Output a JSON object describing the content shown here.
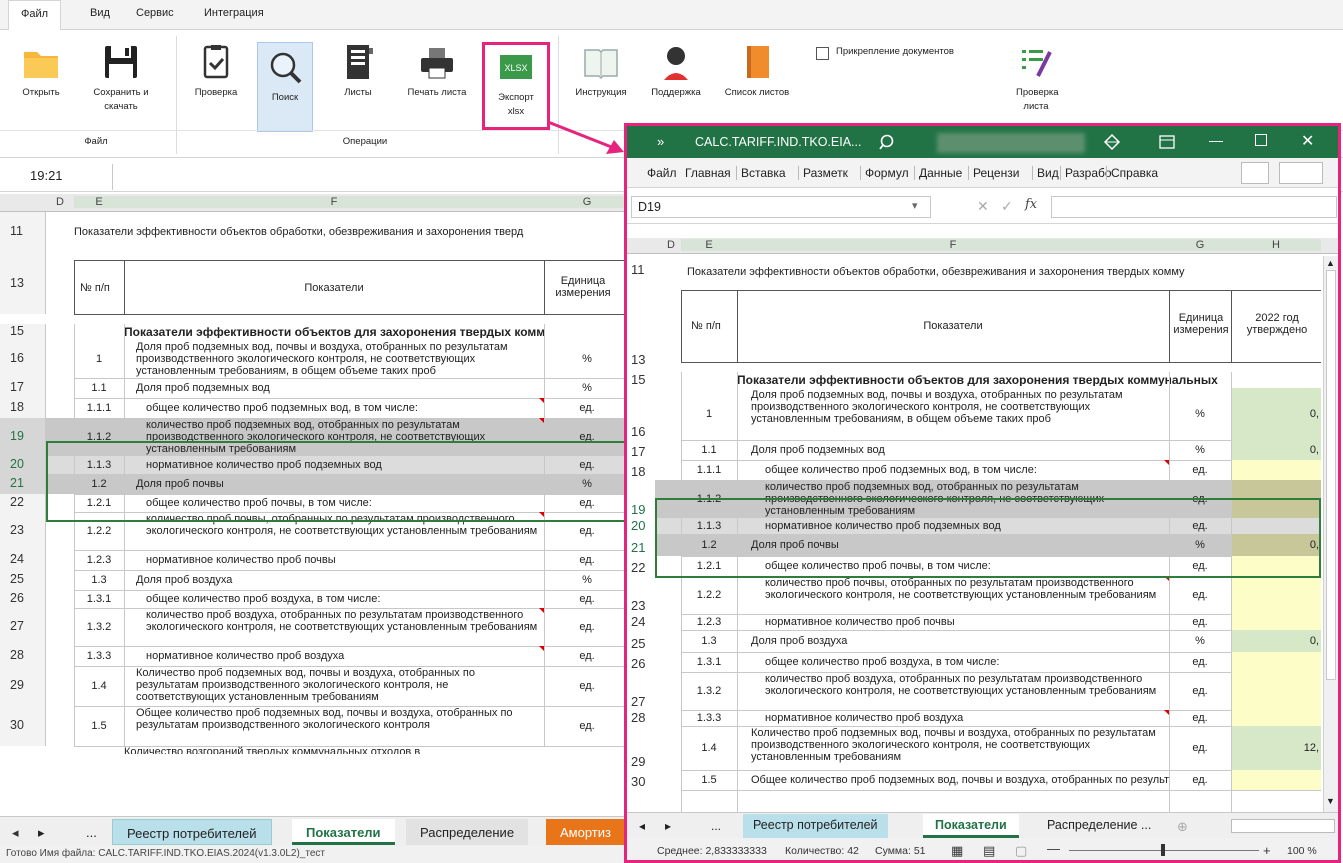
{
  "left_app": {
    "menu": [
      "Файл",
      "Вид",
      "Сервис",
      "Интеграция"
    ],
    "ribbon": {
      "buttons": [
        {
          "id": "open",
          "label": "Открыть"
        },
        {
          "id": "save",
          "label": "Сохранить и скачать"
        },
        {
          "id": "check",
          "label": "Проверка"
        },
        {
          "id": "search",
          "label": "Поиск"
        },
        {
          "id": "sheets",
          "label": "Листы"
        },
        {
          "id": "print",
          "label": "Печать листа"
        },
        {
          "id": "export",
          "label": "Экспорт xlsx",
          "icon_text": "XLSX"
        },
        {
          "id": "manual",
          "label": "Инструкция"
        },
        {
          "id": "support",
          "label": "Поддержка"
        },
        {
          "id": "sheetlist",
          "label": "Список листов"
        },
        {
          "id": "sheetcheck",
          "label": "Проверка листа"
        }
      ],
      "attach_docs_label": "Прикрепление документов",
      "group_file": "Файл",
      "group_ops": "Операции"
    },
    "time": "19:21",
    "col_headers": [
      "D",
      "E",
      "F",
      "G"
    ],
    "header_title": "Показатели эффективности объектов обработки, обезвреживания и захоронения тверд",
    "table_head": {
      "num": "№ п/п",
      "ind": "Показатели",
      "unit": "Единица измерения"
    },
    "section_title": "Показатели эффективности объектов для захоронения твердых комм",
    "rows": [
      {
        "r": "16",
        "n": "1",
        "t": "Доля проб подземных вод, почвы и воздуха, отобранных по результатам производственного экологического контроля, не соответствующих установленным требованиям, в общем объеме таких проб",
        "u": "%"
      },
      {
        "r": "17",
        "n": "1.1",
        "t": "Доля проб подземных вод",
        "u": "%"
      },
      {
        "r": "18",
        "n": "1.1.1",
        "t": "общее количество проб подземных вод, в том числе:",
        "u": "ед."
      },
      {
        "r": "19",
        "n": "1.1.2",
        "t": "количество проб подземных вод, отобранных по результатам производственного экологического контроля, не соответствующих установленным требованиям",
        "u": "ед."
      },
      {
        "r": "20",
        "n": "1.1.3",
        "t": "нормативное количество проб подземных вод",
        "u": "ед."
      },
      {
        "r": "21",
        "n": "1.2",
        "t": "Доля проб почвы",
        "u": "%"
      },
      {
        "r": "22",
        "n": "1.2.1",
        "t": "общее количество проб почвы, в том числе:",
        "u": "ед."
      },
      {
        "r": "23",
        "n": "1.2.2",
        "t": "количество проб почвы, отобранных по результатам производственного экологического контроля, не соответствующих установленным требованиям",
        "u": "ед."
      },
      {
        "r": "24",
        "n": "1.2.3",
        "t": "нормативное количество проб почвы",
        "u": "ед."
      },
      {
        "r": "25",
        "n": "1.3",
        "t": "Доля проб воздуха",
        "u": "%"
      },
      {
        "r": "26",
        "n": "1.3.1",
        "t": "общее количество проб воздуха, в том числе:",
        "u": "ед."
      },
      {
        "r": "27",
        "n": "1.3.2",
        "t": "количество проб воздуха, отобранных по результатам производственного экологического контроля, не соответствующих установленным требованиям",
        "u": "ед."
      },
      {
        "r": "28",
        "n": "1.3.3",
        "t": "нормативное количество проб воздуха",
        "u": "ед."
      },
      {
        "r": "29",
        "n": "1.4",
        "t": "Количество проб подземных вод, почвы и воздуха, отобранных по результатам производственного экологического контроля, не соответствующих установленным требованиям",
        "u": "ед."
      },
      {
        "r": "30",
        "n": "1.5",
        "t": "Общее количество проб подземных вод, почвы и воздуха, отобранных по результатам производственного экологического контроля",
        "u": "ед."
      }
    ],
    "last_row_partial": "Количество возгораний твердых коммунальных отходов в",
    "tabs": [
      "Реестр потребителей",
      "Показатели",
      "Распределение",
      "Амортиз"
    ],
    "tab_more": "...",
    "status": "Готово   Имя файла: CALC.TARIFF.IND.TKO.EIAS.2024(v1.3.0L2)_тест"
  },
  "excel": {
    "title": "CALC.TARIFF.IND.TKO.EIA...",
    "title_chevrons": "»",
    "menu": [
      "Файл",
      "Главная",
      "Вставка",
      "Разметк",
      "Формул",
      "Данные",
      "Рецензи",
      "Вид",
      "Разрабо",
      "Справка"
    ],
    "namebox": "D19",
    "fx": "fx",
    "col_headers": [
      "D",
      "E",
      "F",
      "G",
      "H"
    ],
    "header_title": "Показатели эффективности объектов обработки, обезвреживания и захоронения твердых комму",
    "table_head": {
      "num": "№ п/п",
      "ind": "Показатели",
      "unit": "Единица измерения",
      "year": "2022 год утверждено"
    },
    "section_title": "Показатели эффективности объектов для захоронения твердых коммунальных",
    "values": {
      "16": "0,",
      "17": "0,",
      "21": "0,",
      "25": "0,",
      "29": "12,"
    },
    "tabs": [
      "Реестр потребителей",
      "Показатели",
      "Распределение ..."
    ],
    "tab_more": "...",
    "status": {
      "avg": "Среднее: 2,833333333",
      "count": "Количество: 42",
      "sum": "Сумма: 51",
      "zoom": "100 %"
    }
  },
  "colors": {
    "accent_pink": "#e6247d",
    "excel_green": "#217346",
    "tab_active_green": "#217346",
    "selection_green": "#2f7d3a",
    "orange_tab": "#e8751a"
  }
}
